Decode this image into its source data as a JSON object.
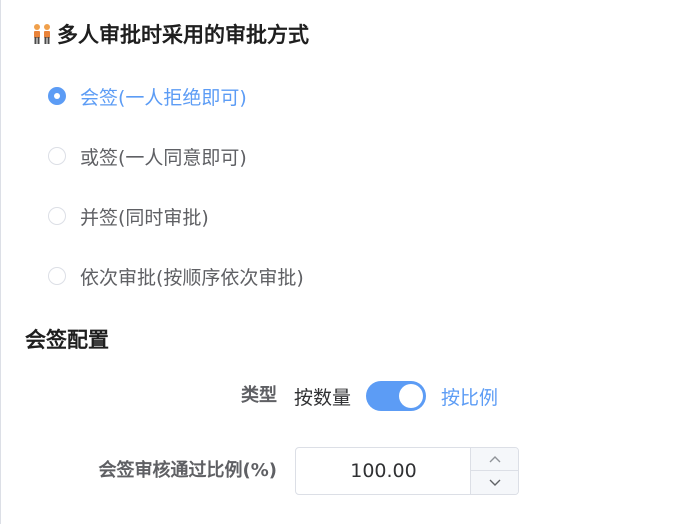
{
  "approval": {
    "title": "多人审批时采用的审批方式",
    "title_icon": "people-icon",
    "options": [
      {
        "label": "会签(一人拒绝即可)",
        "checked": true
      },
      {
        "label": "或签(一人同意即可)",
        "checked": false
      },
      {
        "label": "并签(同时审批)",
        "checked": false
      },
      {
        "label": "依次审批(按顺序依次审批)",
        "checked": false
      }
    ]
  },
  "config": {
    "title": "会签配置",
    "type_label": "类型",
    "switch_off_label": "按数量",
    "switch_on_label": "按比例",
    "switch_on": true,
    "ratio_label": "会签审核通过比例(%)",
    "ratio_value": "100.00"
  },
  "colors": {
    "accent": "#5c9cf5",
    "text": "#303133",
    "muted": "#5f6064",
    "border": "#dcdfe6"
  }
}
